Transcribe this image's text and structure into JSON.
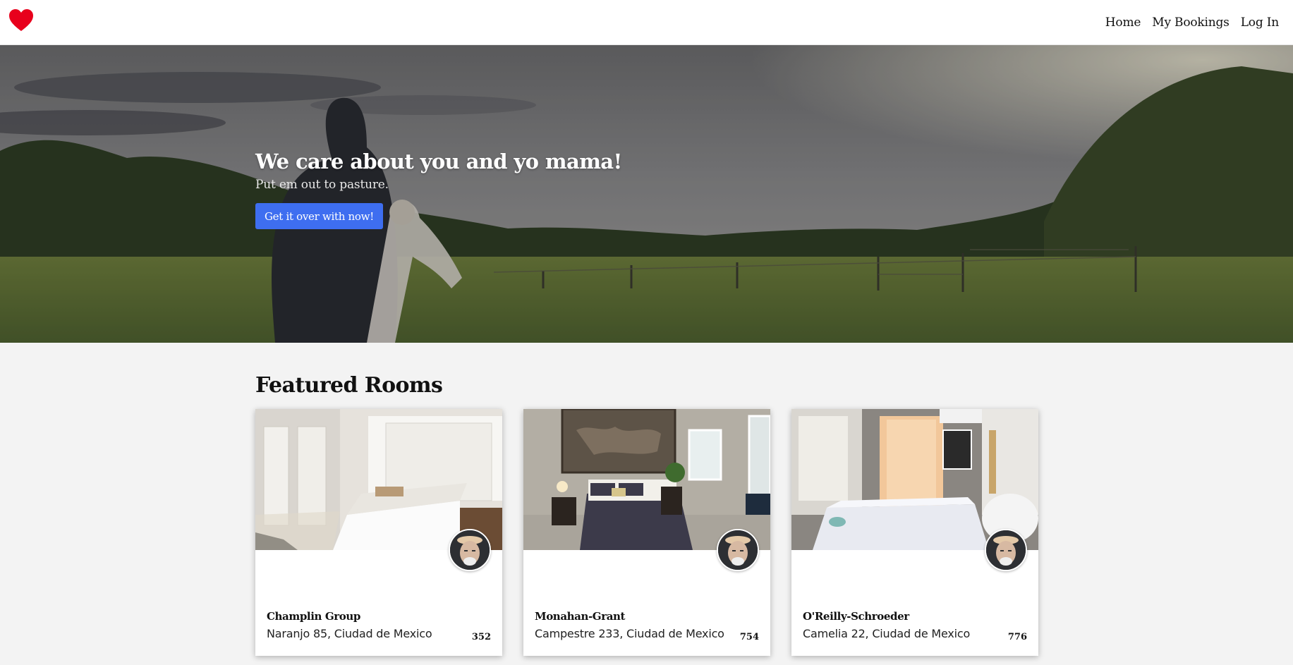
{
  "nav": {
    "logo_icon": "heart-icon",
    "logo_color": "#e8001c",
    "links": [
      {
        "label": "Home"
      },
      {
        "label": "My Bookings"
      },
      {
        "label": "Log In"
      }
    ]
  },
  "hero": {
    "title": "We care about you and yo mama!",
    "subtitle": "Put em out to pasture.",
    "button_label": "Get it over with now!",
    "button_color": "#3e6ef0"
  },
  "featured": {
    "title": "Featured Rooms",
    "rooms": [
      {
        "name": "Champlin Group",
        "address": "Naranjo 85, Ciudad de Mexico",
        "price": "352"
      },
      {
        "name": "Monahan-Grant",
        "address": "Campestre 233, Ciudad de Mexico",
        "price": "754"
      },
      {
        "name": "O'Reilly-Schroeder",
        "address": "Camelia 22, Ciudad de Mexico",
        "price": "776"
      }
    ]
  }
}
